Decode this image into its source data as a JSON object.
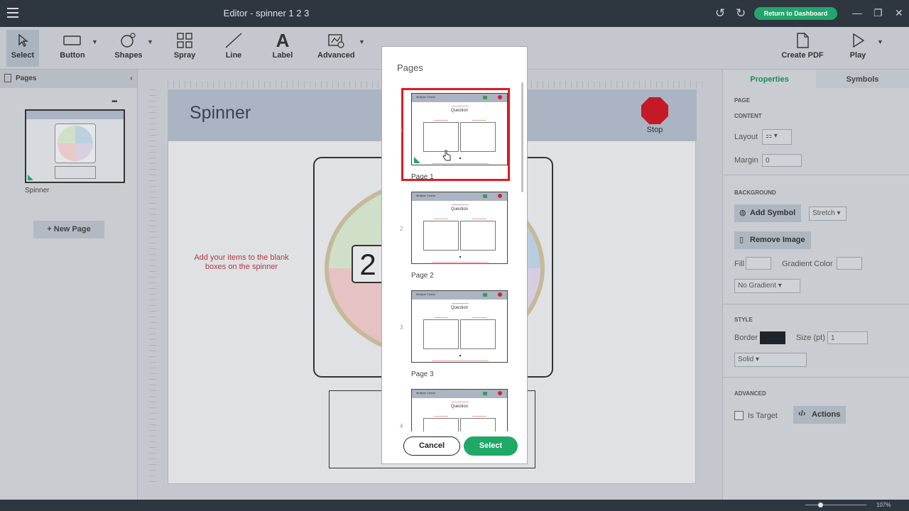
{
  "titlebar": {
    "title": "Editor - spinner 1 2 3",
    "return_label": "Return to Dashboard",
    "undo_icon": "↺",
    "redo_icon": "↻"
  },
  "toolbar": {
    "tools": [
      "Select",
      "Button",
      "Shapes",
      "Spray",
      "Line",
      "Label",
      "Advanced"
    ],
    "create_pdf": "Create PDF",
    "play": "Play"
  },
  "left": {
    "header": "Pages",
    "thumb_label": "Spinner",
    "new_page": "+ New Page",
    "thumb_menu": "•••"
  },
  "canvas": {
    "page_title": "Spinner",
    "stop_label": "Stop",
    "hint": "Add your items to the blank boxes on the spinner",
    "spinner_digit": "2"
  },
  "right": {
    "tab_properties": "Properties",
    "tab_symbols": "Symbols",
    "sec_page": "PAGE",
    "sec_content": "CONTENT",
    "layout": "Layout",
    "margin": "Margin",
    "margin_value": "0",
    "sec_background": "BACKGROUND",
    "add_symbol": "Add Symbol",
    "stretch": "Stretch",
    "remove_image": "Remove Image",
    "fill": "Fill",
    "gradient_color": "Gradient Color",
    "no_gradient": "No Gradient",
    "sec_style": "STYLE",
    "border": "Border",
    "size_pt": "Size (pt)",
    "size_value": "1",
    "solid": "Solid",
    "sec_advanced": "ADVANCED",
    "is_target": "Is Target",
    "actions": "Actions"
  },
  "status": {
    "zoom": "107%"
  },
  "dialog": {
    "title": "Pages",
    "thumb_header": "Multiple Choice",
    "thumb_question": "Question",
    "pages": [
      {
        "num": "1",
        "label": "Page 1"
      },
      {
        "num": "2",
        "label": "Page 2"
      },
      {
        "num": "3",
        "label": "Page 3"
      },
      {
        "num": "4",
        "label": ""
      }
    ],
    "cancel": "Cancel",
    "select": "Select"
  }
}
